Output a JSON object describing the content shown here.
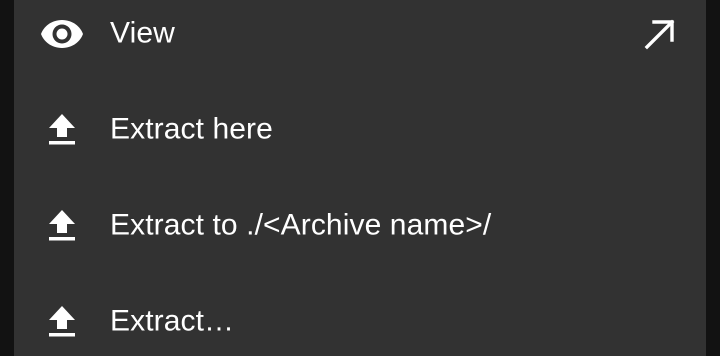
{
  "menu": {
    "items": [
      {
        "label": "View",
        "icon": "eye-icon",
        "trailing_icon": "open-external-arrow-icon"
      },
      {
        "label": "Extract here",
        "icon": "upload-icon"
      },
      {
        "label": "Extract to ./<Archive name>/",
        "icon": "upload-icon"
      },
      {
        "label": "Extract…",
        "icon": "upload-icon"
      }
    ]
  },
  "colors": {
    "menu_background": "#323232",
    "outer_background": "#121212",
    "text": "#ffffff",
    "icon": "#ffffff"
  }
}
